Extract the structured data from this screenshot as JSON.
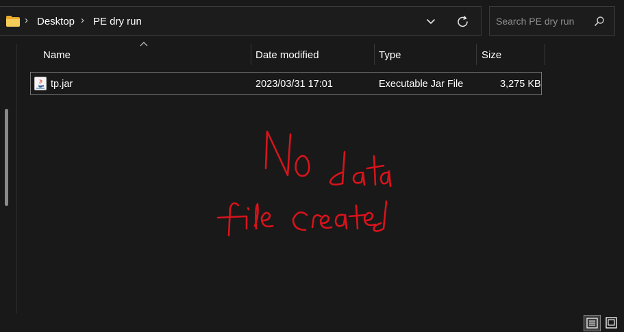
{
  "breadcrumb": {
    "items": [
      "Desktop",
      "PE dry run"
    ],
    "separator": "›"
  },
  "search": {
    "placeholder": "Search PE dry run"
  },
  "columns": {
    "name": "Name",
    "date_modified": "Date modified",
    "type": "Type",
    "size": "Size",
    "sorted_by": "Name"
  },
  "files": [
    {
      "name": "tp.jar",
      "date_modified": "2023/03/31 17:01",
      "type": "Executable Jar File",
      "size": "3,275 KB",
      "icon": "java-jar-icon"
    }
  ],
  "annotation": {
    "text_lines": [
      "No data",
      "file created"
    ],
    "color": "#d9131b"
  },
  "view_modes": {
    "active": "details",
    "available": [
      "details",
      "large-icons"
    ]
  },
  "colors": {
    "background": "#191919",
    "border": "#3a3a3a",
    "text": "#ffffff",
    "placeholder": "#8e8e8e",
    "folder": "#f3c14a"
  }
}
